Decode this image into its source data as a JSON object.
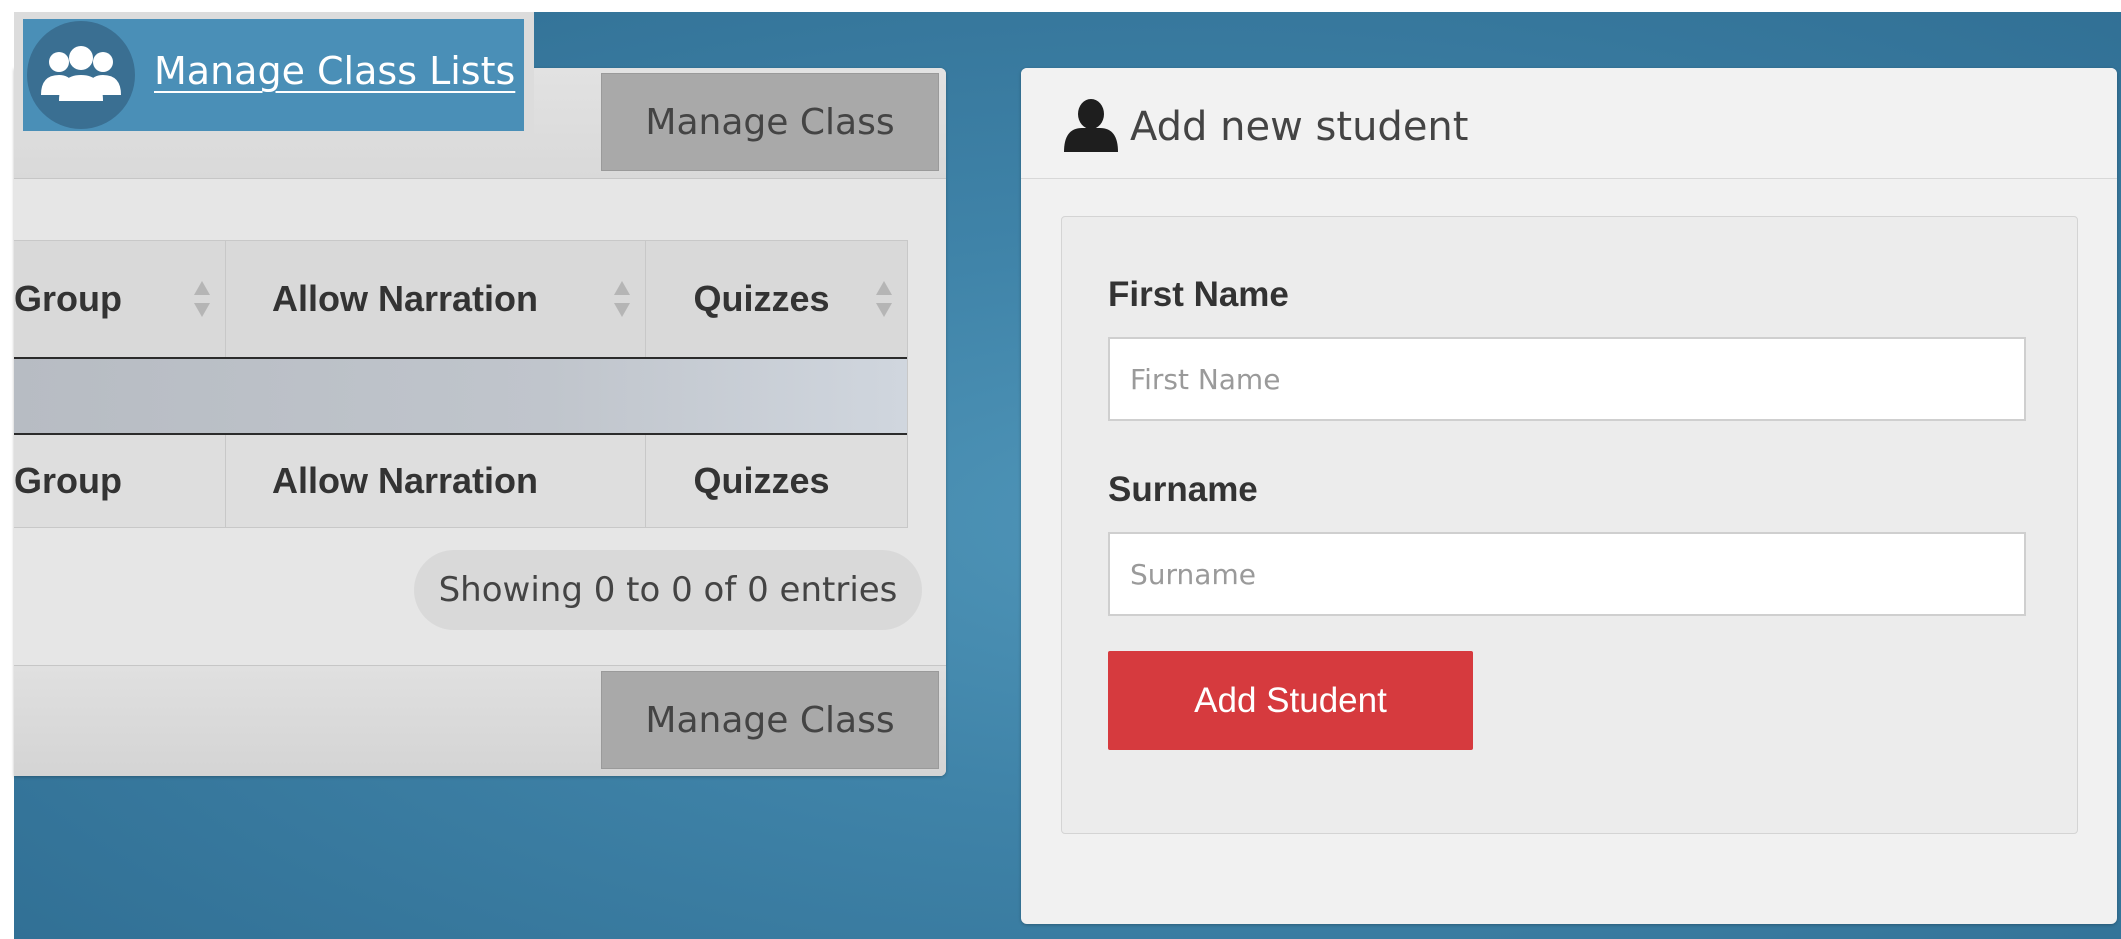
{
  "badge": {
    "label": "Manage Class Lists",
    "icon": "users-group-icon"
  },
  "class_panel": {
    "manage_class_top": "Manage Class",
    "manage_class_bottom": "Manage Class",
    "table": {
      "columns": [
        "Group",
        "Allow Narration",
        "Quizzes"
      ],
      "rows": [],
      "footer_columns": [
        "Group",
        "Allow Narration",
        "Quizzes"
      ]
    },
    "info": "Showing 0 to 0 of 0 entries"
  },
  "student_panel": {
    "title": "Add new student",
    "icon": "user-icon",
    "first_name_label": "First Name",
    "first_name_placeholder": "First Name",
    "first_name_value": "",
    "surname_label": "Surname",
    "surname_placeholder": "Surname",
    "surname_value": "",
    "submit_label": "Add Student"
  },
  "colors": {
    "background": "#3f83a8",
    "badge": "#4a8fb7",
    "accent_red": "#d63a3e",
    "gray_button": "#a9a9a9"
  }
}
